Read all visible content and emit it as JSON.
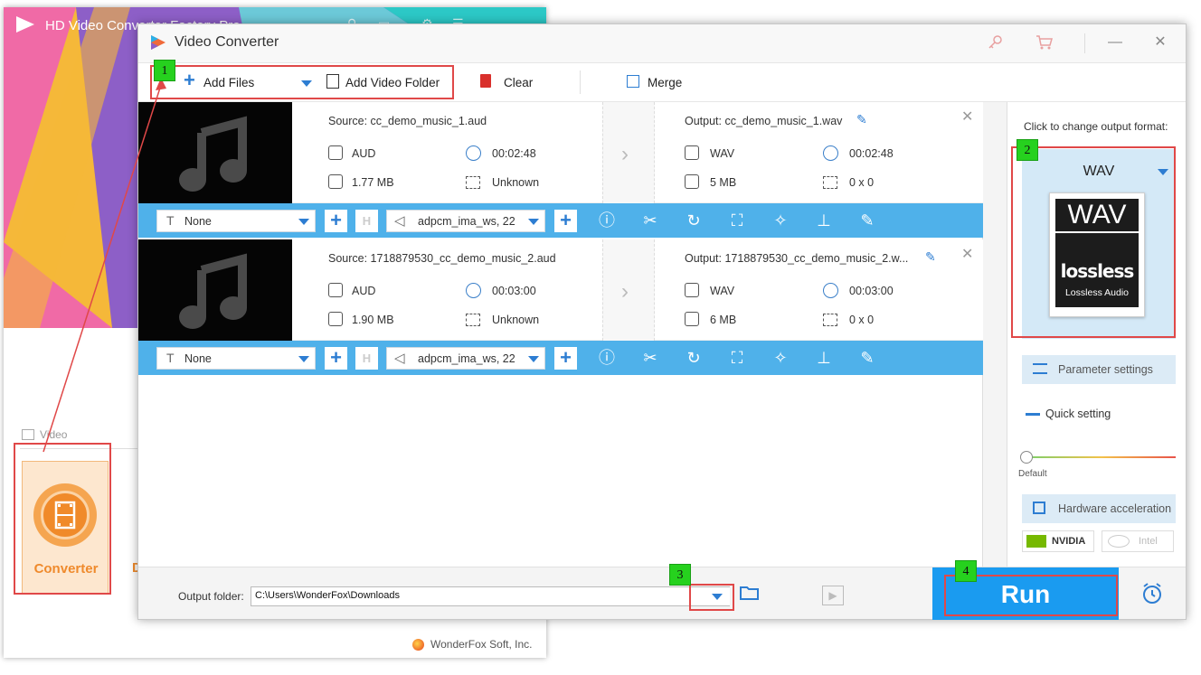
{
  "background_app": {
    "title": "HD Video Converter Factory Pro",
    "section_label": "Video",
    "converter_label": "Converter",
    "partial_tile_letter": "D",
    "footer": "WonderFox Soft, Inc.",
    "colors": {
      "banner_orange": "#f5b839",
      "banner_purple": "#8d5fc7",
      "banner_pink": "#f06aa6",
      "banner_teal": "#2cc8c6",
      "converter_orange": "#ef8a2c"
    }
  },
  "window": {
    "title": "Video Converter",
    "title_icons": [
      "key-icon",
      "cart-icon",
      "minimize-icon",
      "close-icon"
    ],
    "minimize_glyph": "—",
    "close_glyph": "✕"
  },
  "toolbar": {
    "add_files": "Add Files",
    "add_video_folder": "Add Video Folder",
    "clear": "Clear",
    "merge": "Merge"
  },
  "files": [
    {
      "source": "Source: cc_demo_music_1.aud",
      "source_format": "AUD",
      "source_duration": "00:02:48",
      "source_size": "1.77 MB",
      "source_resolution": "Unknown",
      "output": "Output: cc_demo_music_1.wav",
      "output_format": "WAV",
      "output_duration": "00:02:48",
      "output_size": "5 MB",
      "output_resolution": "0 x 0",
      "subtitle": "None",
      "audio_track": "adpcm_ima_ws, 22"
    },
    {
      "source": "Source: 1718879530_cc_demo_music_2.aud",
      "source_format": "AUD",
      "source_duration": "00:03:00",
      "source_size": "1.90 MB",
      "source_resolution": "Unknown",
      "output": "Output: 1718879530_cc_demo_music_2.w...",
      "output_format": "WAV",
      "output_duration": "00:03:00",
      "output_size": "6 MB",
      "output_resolution": "0 x 0",
      "subtitle": "None",
      "audio_track": "adpcm_ima_ws, 22"
    }
  ],
  "tool_icons": [
    "info-icon",
    "scissors-icon",
    "rotate-icon",
    "crop-icon",
    "effects-wand-icon",
    "watermark-stamp-icon",
    "subtitle-edit-icon"
  ],
  "right_panel": {
    "caption": "Click to change output format:",
    "format": "WAV",
    "format_icon_top": "WAV",
    "format_icon_main": "lossless",
    "format_icon_sub": "Lossless Audio",
    "parameter_settings": "Parameter settings",
    "quick_setting": "Quick setting",
    "slider_label": "Default",
    "hardware_acceleration": "Hardware acceleration",
    "nvidia": "NVIDIA",
    "intel": "Intel"
  },
  "bottom": {
    "output_folder_label": "Output folder:",
    "output_folder_path": "C:\\Users\\WonderFox\\Downloads",
    "run": "Run"
  },
  "annotations": {
    "step1": "1",
    "step2": "2",
    "step3": "3",
    "step4": "4",
    "highlight_color": "#e04848",
    "badge_color": "#26d11e"
  },
  "colors": {
    "toolbar_blue": "#4fb1ea",
    "run_blue": "#1a9bf0",
    "accent_blue": "#2d7dd2",
    "clear_red": "#d9302c"
  }
}
